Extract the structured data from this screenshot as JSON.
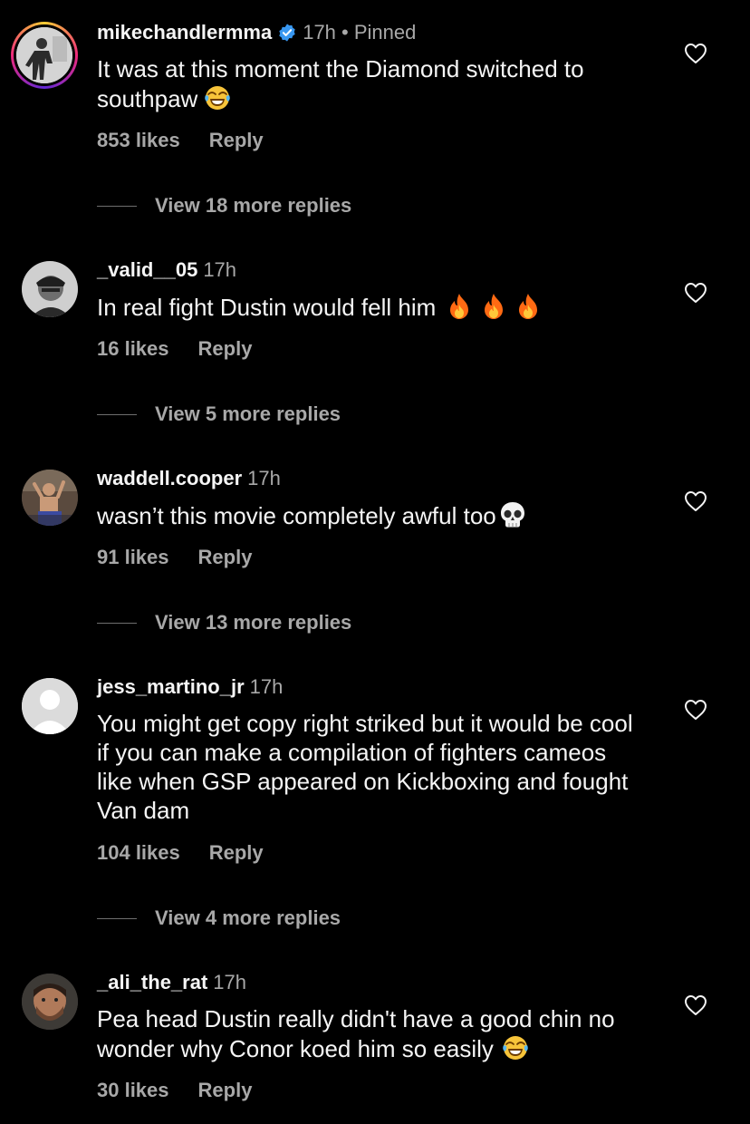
{
  "comments": [
    {
      "username": "mikechandlermma",
      "time": "17h",
      "pinned": "• Pinned",
      "text": "It was at this moment the Diamond switched to southpaw",
      "likes": "853 likes",
      "reply": "Reply",
      "view_replies": "View 18 more replies",
      "emoji": "laughing-crying-emoji"
    },
    {
      "username": "_valid__05",
      "time": "17h",
      "text": "In real fight Dustin would fell him",
      "likes": "16 likes",
      "reply": "Reply",
      "view_replies": "View 5 more replies",
      "emoji": "fire-emoji x3"
    },
    {
      "username": "waddell.cooper",
      "time": "17h",
      "text": "wasn’t this movie completely awful too",
      "likes": "91 likes",
      "reply": "Reply",
      "view_replies": "View 13 more replies",
      "emoji": "skull-emoji"
    },
    {
      "username": "jess_martino_jr",
      "time": "17h",
      "text": "You might get copy right striked but it would be cool if you can make a compilation of fighters cameos like when GSP appeared on Kickboxing and fought Van dam",
      "likes": "104 likes",
      "reply": "Reply",
      "view_replies": "View 4 more replies"
    },
    {
      "username": "_ali_the_rat",
      "time": "17h",
      "text": "Pea head Dustin really didn't have a good chin no wonder why Conor koed him so easily",
      "likes": "30 likes",
      "reply": "Reply",
      "emoji": "laughing-crying-emoji"
    }
  ],
  "colors": {
    "background": "#000000",
    "primary_text": "#f5f5f5",
    "secondary_text": "#a8a8a8",
    "verified": "#3897f0"
  }
}
